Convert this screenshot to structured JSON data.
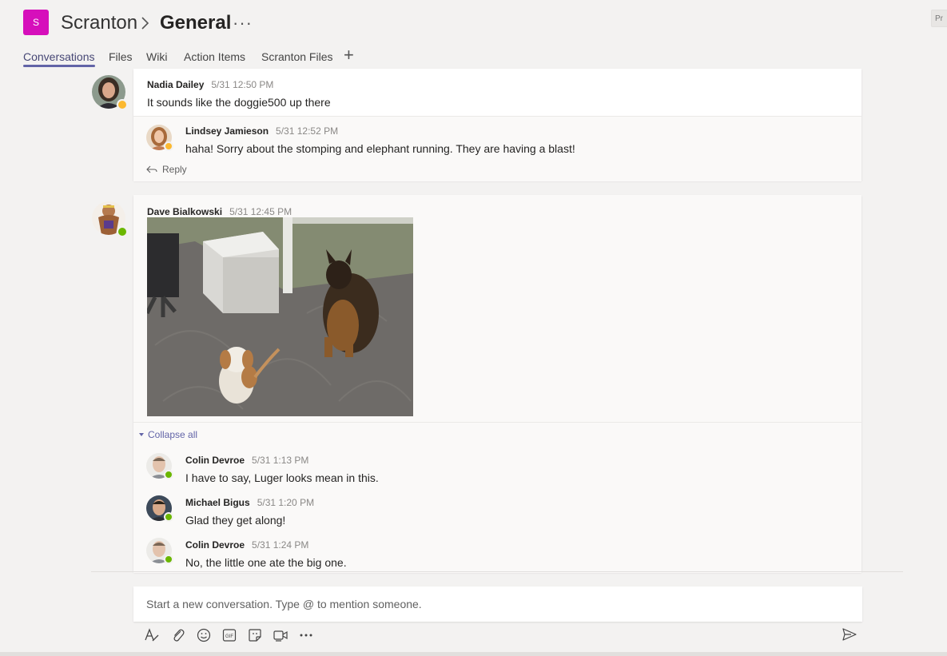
{
  "header": {
    "team_initial": "S",
    "team_name": "Scranton",
    "separator": ">",
    "channel_name": "General",
    "more": "···",
    "right_stub": "Pr"
  },
  "tabs": [
    {
      "label": "Conversations",
      "active": true
    },
    {
      "label": "Files",
      "active": false
    },
    {
      "label": "Wiki",
      "active": false
    },
    {
      "label": "Action Items",
      "active": false
    },
    {
      "label": "Scranton Files",
      "active": false
    }
  ],
  "tab_add": "+",
  "threads": [
    {
      "author": "Nadia Dailey",
      "time": "5/31 12:50 PM",
      "text": "It sounds like the doggie500 up there",
      "presence": "away",
      "replies": [
        {
          "author": "Lindsey Jamieson",
          "time": "5/31 12:52 PM",
          "text": "haha! Sorry about the stomping and elephant running. They are having a blast!",
          "presence": "away"
        }
      ],
      "reply_label": "Reply"
    },
    {
      "author": "Dave Bialkowski",
      "time": "5/31 12:45 PM",
      "presence": "available",
      "collapse_label": "Collapse all",
      "replies": [
        {
          "author": "Colin Devroe",
          "time": "5/31 1:13 PM",
          "text": "I have to say, Luger looks mean in this.",
          "presence": "available"
        },
        {
          "author": "Michael Bigus",
          "time": "5/31 1:20 PM",
          "text": "Glad they get along!",
          "presence": "available"
        },
        {
          "author": "Colin Devroe",
          "time": "5/31 1:24 PM",
          "text": "No, the little one ate the big one.",
          "presence": "available"
        }
      ]
    }
  ],
  "compose": {
    "placeholder": "Start a new conversation. Type @ to mention someone."
  },
  "toolbar": [
    {
      "icon": "format-icon"
    },
    {
      "icon": "attach-icon"
    },
    {
      "icon": "emoji-icon"
    },
    {
      "icon": "gif-icon"
    },
    {
      "icon": "sticker-icon"
    },
    {
      "icon": "meet-now-icon"
    },
    {
      "icon": "more-options-icon"
    }
  ],
  "colors": {
    "accent": "#6264a7",
    "team_tile": "#d60fbb",
    "away": "#fcb930",
    "available": "#6bb700"
  }
}
